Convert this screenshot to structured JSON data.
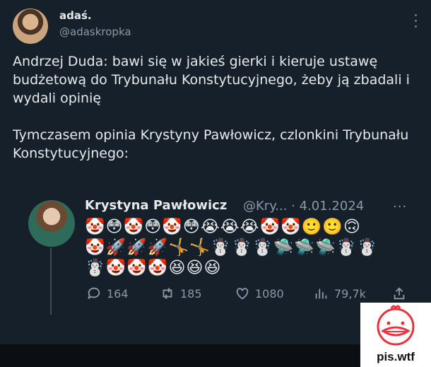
{
  "tweet": {
    "name": "adaś.",
    "handle": "@adaskropka",
    "body": "Andrzej Duda: bawi się w jakieś gierki i kieruje ustawę budżetową do Trybunału Konstytucyjnego, żeby ją zbadali i wydali opinię\n\nTymczasem opinia Krystyny Pawłowicz, czlonkini Trybunału Konstytucyjnego:"
  },
  "quoted": {
    "name": "Krystyna Pawłowicz",
    "handle_date": "@Kry... · 4.01.2024",
    "more": "···",
    "emoji_lines": [
      "🤡😳🤡😳🤡😳😭😭😭🤡🤡🙂🙂🙃",
      "🤡🚀🚀🚀🤸🤸☃️☃️☃️🛸🛸🛸☃️☃️",
      "☃️🤡🤡🤡😆😆😆"
    ]
  },
  "actions": {
    "replies": "164",
    "retweets": "185",
    "likes": "1080",
    "views": "79,7k"
  },
  "watermark": {
    "text": "pis.wtf",
    "color": "#e8323c"
  },
  "colors": {
    "background": "#15202b",
    "text": "#e7e9ea",
    "muted": "#8b98a5"
  }
}
